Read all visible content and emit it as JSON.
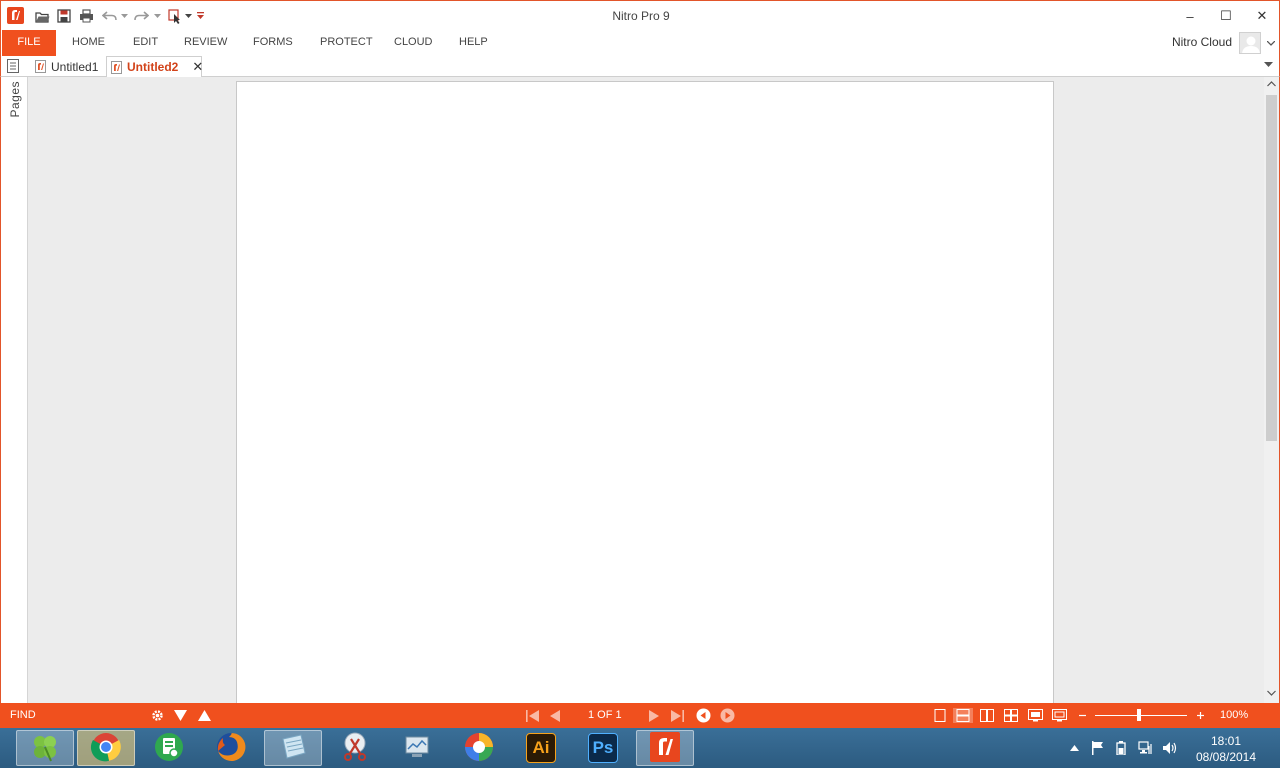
{
  "window": {
    "title": "Nitro Pro 9",
    "accent_color": "#f0501e",
    "controls": {
      "minimize": "–",
      "maximize": "☐",
      "close": "✕"
    }
  },
  "quick_access": {
    "icons": [
      "open-folder-icon",
      "save-icon",
      "print-icon",
      "undo-icon",
      "redo-icon",
      "select-tool-icon",
      "customize-toolbar-icon"
    ]
  },
  "ribbon": {
    "tabs": [
      {
        "label": "FILE"
      },
      {
        "label": "HOME"
      },
      {
        "label": "EDIT"
      },
      {
        "label": "REVIEW"
      },
      {
        "label": "FORMS"
      },
      {
        "label": "PROTECT"
      },
      {
        "label": "CLOUD"
      },
      {
        "label": "HELP"
      }
    ],
    "account_label": "Nitro Cloud"
  },
  "document_tabs": [
    {
      "label": "Untitled1",
      "active": false
    },
    {
      "label": "Untitled2",
      "active": true
    }
  ],
  "left_panel": {
    "label": "Pages"
  },
  "status_bar": {
    "find_label": "FIND",
    "page_indicator": "1 OF 1",
    "zoom_level": "100%",
    "zoom_fraction": 0.48
  },
  "taskbar": {
    "apps": [
      {
        "name": "clover-app",
        "active": true
      },
      {
        "name": "chrome",
        "active": true
      },
      {
        "name": "document-app",
        "active": false
      },
      {
        "name": "firefox",
        "active": false
      },
      {
        "name": "notes-app",
        "active": true
      },
      {
        "name": "snipping-tool",
        "active": false
      },
      {
        "name": "monitor-app",
        "active": false
      },
      {
        "name": "picasa",
        "active": false
      },
      {
        "name": "illustrator",
        "label": "Ai",
        "active": false
      },
      {
        "name": "photoshop",
        "label": "Ps",
        "active": false
      },
      {
        "name": "nitro-pro",
        "active": true
      }
    ],
    "clock_time": "18:01",
    "clock_date": "08/08/2014"
  }
}
